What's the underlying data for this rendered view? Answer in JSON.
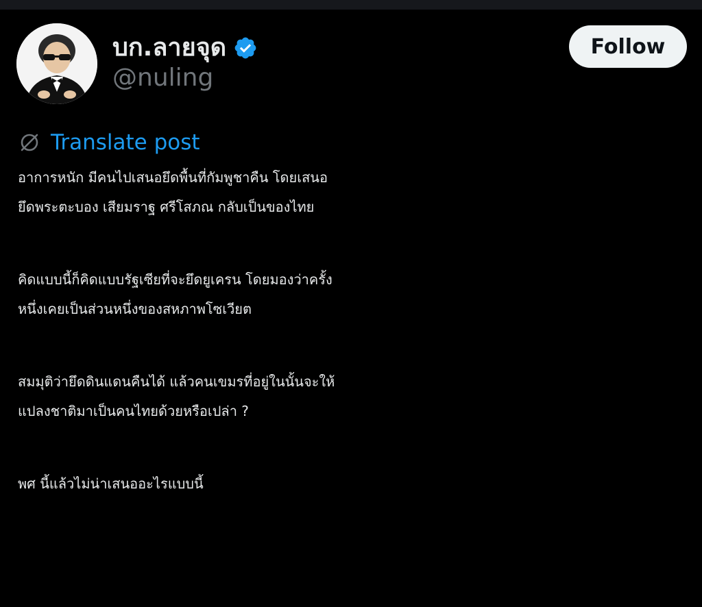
{
  "author": {
    "display_name": "บก.ลายจุด",
    "handle": "@nuling",
    "verified": true,
    "verified_color": "#1d9bf0"
  },
  "follow_button": {
    "label": "Follow"
  },
  "translate": {
    "icon": "globe-slash-icon",
    "label": "Translate post",
    "color": "#1d9bf0"
  },
  "post": {
    "paragraphs": [
      {
        "lines": [
          "อาการหนัก มีคนไปเสนอยึดพื้นที่กัมพูชาคืน โดยเสนอ",
          "ยึดพระตะบอง เสียมราฐ ศรีโสภณ กลับเป็นของไทย"
        ]
      },
      {
        "lines": [
          "คิดแบบนี้ก็คิดแบบรัฐเซียที่จะยึดยูเครน โดยมองว่าครั้ง",
          "หนึ่งเคยเป็นส่วนหนึ่งของสหภาพโซเวียต"
        ]
      },
      {
        "lines": [
          "สมมุติว่ายึดดินแดนคืนได้ แล้วคนเขมรที่อยู่ในนั้นจะให้",
          "แปลงชาติมาเป็นคนไทยด้วยหรือเปล่า ?"
        ]
      },
      {
        "lines": [
          "พศ นี้แล้วไม่น่าเสนออะไรแบบนี้"
        ]
      }
    ]
  },
  "theme": {
    "background": "#000000",
    "text": "#e7e9ea",
    "secondary_text": "#71767b",
    "accent": "#1d9bf0"
  }
}
